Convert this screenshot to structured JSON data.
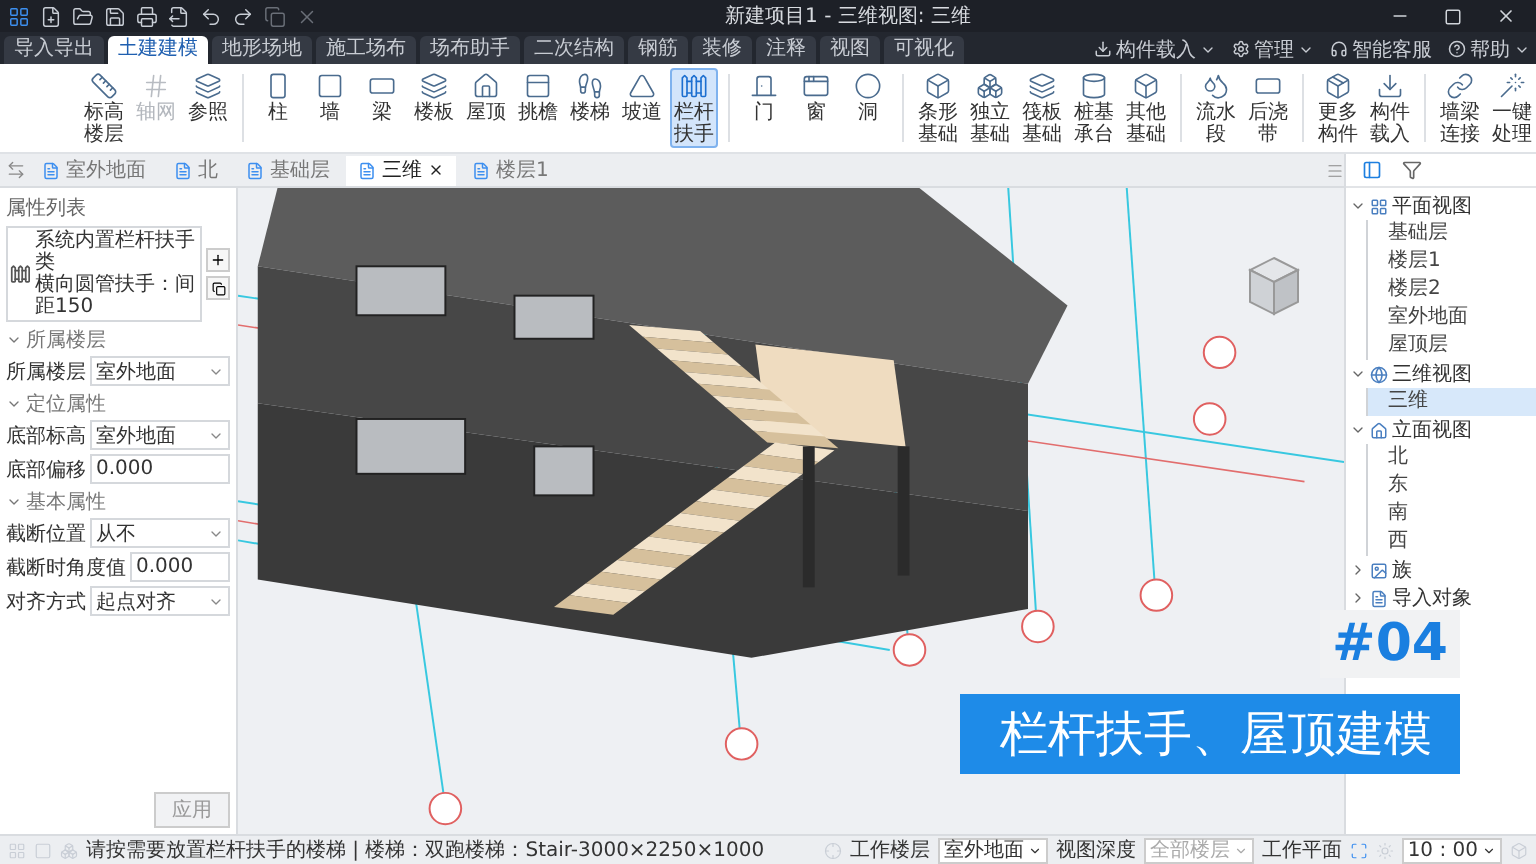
{
  "title_bar": {
    "title": "新建项目1 - 三维视图: 三维"
  },
  "menu_tabs": [
    {
      "label": "导入导出",
      "selected": false
    },
    {
      "label": "土建建模",
      "selected": true
    },
    {
      "label": "地形场地",
      "selected": false
    },
    {
      "label": "施工场布",
      "selected": false
    },
    {
      "label": "场布助手",
      "selected": false
    },
    {
      "label": "二次结构",
      "selected": false
    },
    {
      "label": "钢筋",
      "selected": false
    },
    {
      "label": "装修",
      "selected": false
    },
    {
      "label": "注释",
      "selected": false
    },
    {
      "label": "视图",
      "selected": false
    },
    {
      "label": "可视化",
      "selected": false
    }
  ],
  "account_menu": [
    {
      "label": "构件载入",
      "dropdown": true
    },
    {
      "label": "管理",
      "dropdown": true
    },
    {
      "label": "智能客服",
      "dropdown": false
    },
    {
      "label": "帮助",
      "dropdown": true
    }
  ],
  "ribbon": {
    "groups": [
      {
        "tools": [
          {
            "label": "标高楼层",
            "selected": false,
            "disabled": false
          },
          {
            "label": "轴网",
            "selected": false,
            "disabled": true
          },
          {
            "label": "参照",
            "selected": false,
            "disabled": false
          }
        ]
      },
      {
        "tools": [
          {
            "label": "柱",
            "selected": false,
            "disabled": false
          },
          {
            "label": "墙",
            "selected": false,
            "disabled": false
          },
          {
            "label": "梁",
            "selected": false,
            "disabled": false
          },
          {
            "label": "楼板",
            "selected": false,
            "disabled": false
          },
          {
            "label": "屋顶",
            "selected": false,
            "disabled": false
          },
          {
            "label": "挑檐",
            "selected": false,
            "disabled": false
          },
          {
            "label": "楼梯",
            "selected": false,
            "disabled": false
          },
          {
            "label": "坡道",
            "selected": false,
            "disabled": false
          },
          {
            "label": "栏杆扶手",
            "selected": true,
            "disabled": false
          }
        ]
      },
      {
        "tools": [
          {
            "label": "门",
            "selected": false,
            "disabled": false
          },
          {
            "label": "窗",
            "selected": false,
            "disabled": false
          },
          {
            "label": "洞",
            "selected": false,
            "disabled": false
          }
        ]
      },
      {
        "tools": [
          {
            "label": "条形基础",
            "selected": false,
            "disabled": false
          },
          {
            "label": "独立基础",
            "selected": false,
            "disabled": false
          },
          {
            "label": "筏板基础",
            "selected": false,
            "disabled": false
          },
          {
            "label": "桩基承台",
            "selected": false,
            "disabled": false
          },
          {
            "label": "其他基础",
            "selected": false,
            "disabled": false
          }
        ]
      },
      {
        "tools": [
          {
            "label": "流水段",
            "selected": false,
            "disabled": false
          },
          {
            "label": "后浇带",
            "selected": false,
            "disabled": false
          }
        ]
      },
      {
        "tools": [
          {
            "label": "更多构件",
            "selected": false,
            "disabled": false
          },
          {
            "label": "构件载入",
            "selected": false,
            "disabled": false
          }
        ]
      },
      {
        "tools": [
          {
            "label": "墙梁连接",
            "selected": false,
            "disabled": false
          },
          {
            "label": "一键处理",
            "selected": false,
            "disabled": false
          }
        ]
      }
    ]
  },
  "view_tabs": [
    {
      "label": "室外地面",
      "selected": false
    },
    {
      "label": "北",
      "selected": false
    },
    {
      "label": "基础层",
      "selected": false
    },
    {
      "label": "三维",
      "selected": true
    },
    {
      "label": "楼层1",
      "selected": false
    }
  ],
  "properties": {
    "title": "属性列表",
    "type_name": "系统内置栏杆扶手类",
    "type_detail": "横向圆管扶手：间距150",
    "sections": [
      {
        "title": "所属楼层",
        "expanded": true,
        "rows": [
          {
            "label": "所属楼层",
            "value": "室外地面",
            "kind": "select"
          }
        ]
      },
      {
        "title": "定位属性",
        "expanded": true,
        "rows": [
          {
            "label": "底部标高",
            "value": "室外地面",
            "kind": "select"
          },
          {
            "label": "底部偏移",
            "value": "0.000",
            "kind": "input"
          }
        ]
      },
      {
        "title": "基本属性",
        "expanded": true,
        "rows": [
          {
            "label": "截断位置",
            "value": "从不",
            "kind": "select"
          },
          {
            "label": "截断时角度值",
            "value": "0.000",
            "kind": "input"
          },
          {
            "label": "对齐方式",
            "value": "起点对齐",
            "kind": "select"
          }
        ]
      }
    ],
    "apply_button": "应用"
  },
  "viewport": {
    "episode": "#04",
    "caption": "栏杆扶手、屋顶建模"
  },
  "project_browser": {
    "tree": [
      {
        "label": "平面视图",
        "expanded": true,
        "children": [
          {
            "label": "基础层",
            "selected": false
          },
          {
            "label": "楼层1",
            "selected": false
          },
          {
            "label": "楼层2",
            "selected": false
          },
          {
            "label": "室外地面",
            "selected": false
          },
          {
            "label": "屋顶层",
            "selected": false
          }
        ]
      },
      {
        "label": "三维视图",
        "expanded": true,
        "children": [
          {
            "label": "三维",
            "selected": true
          }
        ]
      },
      {
        "label": "立面视图",
        "expanded": true,
        "children": [
          {
            "label": "北",
            "selected": false
          },
          {
            "label": "东",
            "selected": false
          },
          {
            "label": "南",
            "selected": false
          },
          {
            "label": "西",
            "selected": false
          }
        ]
      },
      {
        "label": "族",
        "expanded": false
      },
      {
        "label": "导入对象",
        "expanded": false
      }
    ]
  },
  "status_bar": {
    "message": "请按需要放置栏杆扶手的楼梯 | 楼梯：双跑楼梯：Stair-3000×2250×1000",
    "work_floor_label": "工作楼层",
    "work_floor": "室外地面",
    "view_depth_label": "视图深度",
    "view_depth": {
      "value": "全部楼层",
      "disabled": true
    },
    "work_plane_label": "工作平面",
    "scale": "10 : 00"
  }
}
